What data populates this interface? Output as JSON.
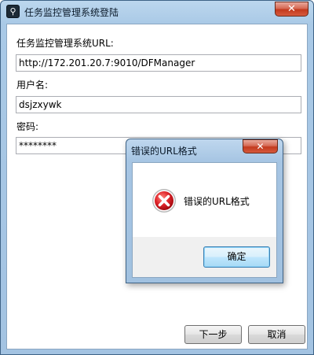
{
  "window": {
    "title": "任务监控管理系统登陆",
    "app_icon_glyph": "⚲",
    "close_glyph": "✕"
  },
  "form": {
    "url_label": "任务监控管理系统URL:",
    "url_value": "http://172.201.20.7:9010/DFManager",
    "username_label": "用户名:",
    "username_value": "dsjzxywk",
    "password_label": "密码:",
    "password_value": "********"
  },
  "buttons": {
    "next_label": "下一步",
    "cancel_label": "取消"
  },
  "dialog": {
    "title": "错误的URL格式",
    "message": "错误的URL格式",
    "ok_label": "确定",
    "close_glyph": "✕",
    "icon": "error-icon"
  },
  "colors": {
    "title_bar": "#a9c9e6",
    "close_button": "#c3391d",
    "error_icon_red": "#d8222a",
    "ok_button_border": "#3c7fb1"
  }
}
